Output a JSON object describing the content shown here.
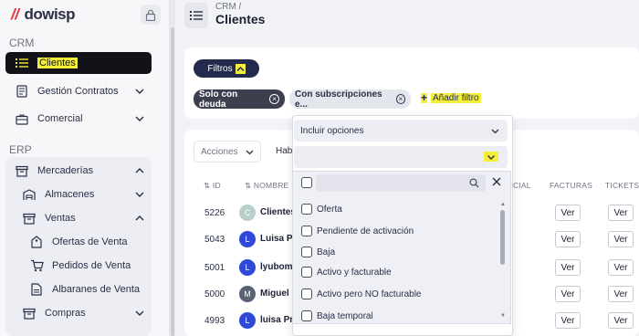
{
  "app": {
    "logo": "dowisp"
  },
  "sidebar": {
    "crm_label": "CRM",
    "erp_label": "ERP",
    "items": [
      {
        "label": "Clientes"
      },
      {
        "label": "Gestión Contratos"
      },
      {
        "label": "Comercial"
      },
      {
        "label": "Mercaderías"
      },
      {
        "label": "Almacenes"
      },
      {
        "label": "Ventas"
      },
      {
        "label": "Ofertas de Venta"
      },
      {
        "label": "Pedidos de Venta"
      },
      {
        "label": "Albaranes de Venta"
      },
      {
        "label": "Compras"
      }
    ]
  },
  "header": {
    "breadcrumb": "CRM /",
    "title": "Clientes"
  },
  "filters": {
    "toggle_label": "Filtros",
    "chips": [
      {
        "label": "Solo con deuda"
      },
      {
        "label": "Con subscripciones e..."
      }
    ],
    "add_label": "Añadir filtro"
  },
  "toolbar": {
    "acciones_label": "Acciones",
    "hab_label": "Hab"
  },
  "table": {
    "headers": {
      "id": "ID",
      "nombre": "NOMBRE",
      "comercial": "CIAL",
      "facturas": "FACTURAS",
      "tickets": "TICKETS"
    },
    "rows": [
      {
        "id": "5226",
        "initial": "C",
        "name": "Clientes",
        "color": "#b9cfcb",
        "button": "Ver",
        "button2": "Ver"
      },
      {
        "id": "5043",
        "initial": "L",
        "name": "Luisa Pru",
        "color": "#2f49d6",
        "button": "Ver",
        "button2": "Ver"
      },
      {
        "id": "5001",
        "initial": "L",
        "name": "lyubomi",
        "color": "#2f49d6",
        "button": "Ver",
        "button2": "Ver"
      },
      {
        "id": "5000",
        "initial": "M",
        "name": "Miguel I",
        "color": "#5b6275",
        "button": "Ver",
        "button2": "Ver"
      },
      {
        "id": "4993",
        "initial": "L",
        "name": "luisa Pru",
        "color": "#2f49d6",
        "button": "Ver",
        "button2": "Ver"
      }
    ]
  },
  "dropdown": {
    "select_label": "Incluir opciones",
    "options": [
      {
        "label": "Oferta"
      },
      {
        "label": "Pendiente de activación"
      },
      {
        "label": "Baja"
      },
      {
        "label": "Activo y facturable"
      },
      {
        "label": "Activo pero NO facturable"
      },
      {
        "label": "Baja temporal"
      }
    ]
  },
  "colors": {
    "highlight": "#f5ef3a",
    "dark": "#232a4d",
    "active_nav": "#111217"
  }
}
